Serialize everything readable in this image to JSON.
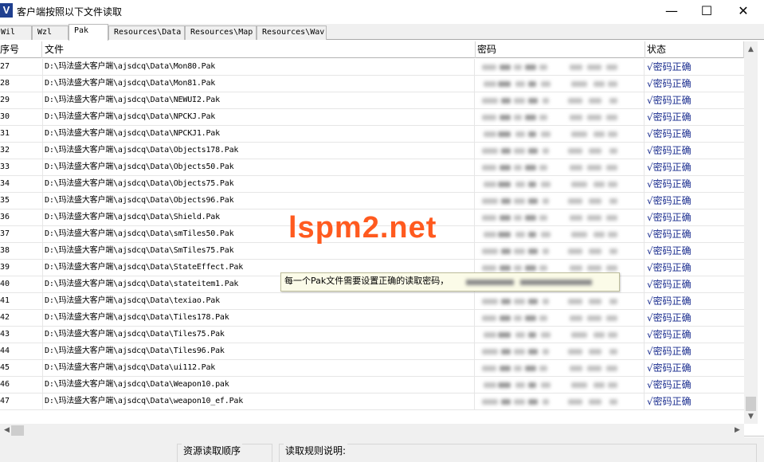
{
  "window": {
    "title": "客户端按照以下文件读取",
    "icon_letter": "V",
    "minimize": "—",
    "maximize": "☐",
    "close": "✕"
  },
  "tabs": [
    "Wil",
    "Wzl",
    "Pak",
    "Resources\\Data",
    "Resources\\Map",
    "Resources\\Wav"
  ],
  "active_tab": "Pak",
  "columns": {
    "id": "序号",
    "file": "文件",
    "password": "密码",
    "status": "状态"
  },
  "rows": [
    {
      "id": "27",
      "file": "D:\\玛法盛大客户端\\ajsdcq\\Data\\Mon80.Pak",
      "status": "√密码正确"
    },
    {
      "id": "28",
      "file": "D:\\玛法盛大客户端\\ajsdcq\\Data\\Mon81.Pak",
      "status": "√密码正确"
    },
    {
      "id": "29",
      "file": "D:\\玛法盛大客户端\\ajsdcq\\Data\\NEWUI2.Pak",
      "status": "√密码正确"
    },
    {
      "id": "30",
      "file": "D:\\玛法盛大客户端\\ajsdcq\\Data\\NPCKJ.Pak",
      "status": "√密码正确"
    },
    {
      "id": "31",
      "file": "D:\\玛法盛大客户端\\ajsdcq\\Data\\NPCKJ1.Pak",
      "status": "√密码正确"
    },
    {
      "id": "32",
      "file": "D:\\玛法盛大客户端\\ajsdcq\\Data\\Objects178.Pak",
      "status": "√密码正确"
    },
    {
      "id": "33",
      "file": "D:\\玛法盛大客户端\\ajsdcq\\Data\\Objects50.Pak",
      "status": "√密码正确"
    },
    {
      "id": "34",
      "file": "D:\\玛法盛大客户端\\ajsdcq\\Data\\Objects75.Pak",
      "status": "√密码正确"
    },
    {
      "id": "35",
      "file": "D:\\玛法盛大客户端\\ajsdcq\\Data\\Objects96.Pak",
      "status": "√密码正确"
    },
    {
      "id": "36",
      "file": "D:\\玛法盛大客户端\\ajsdcq\\Data\\Shield.Pak",
      "status": "√密码正确"
    },
    {
      "id": "37",
      "file": "D:\\玛法盛大客户端\\ajsdcq\\Data\\smTiles50.Pak",
      "status": "√密码正确"
    },
    {
      "id": "38",
      "file": "D:\\玛法盛大客户端\\ajsdcq\\Data\\SmTiles75.Pak",
      "status": "√密码正确"
    },
    {
      "id": "39",
      "file": "D:\\玛法盛大客户端\\ajsdcq\\Data\\StateEffect.Pak",
      "status": "√密码正确"
    },
    {
      "id": "40",
      "file": "D:\\玛法盛大客户端\\ajsdcq\\Data\\stateitem1.Pak",
      "status": "√密码正确"
    },
    {
      "id": "41",
      "file": "D:\\玛法盛大客户端\\ajsdcq\\Data\\texiao.Pak",
      "status": "√密码正确"
    },
    {
      "id": "42",
      "file": "D:\\玛法盛大客户端\\ajsdcq\\Data\\Tiles178.Pak",
      "status": "√密码正确"
    },
    {
      "id": "43",
      "file": "D:\\玛法盛大客户端\\ajsdcq\\Data\\Tiles75.Pak",
      "status": "√密码正确"
    },
    {
      "id": "44",
      "file": "D:\\玛法盛大客户端\\ajsdcq\\Data\\Tiles96.Pak",
      "status": "√密码正确"
    },
    {
      "id": "45",
      "file": "D:\\玛法盛大客户端\\ajsdcq\\Data\\ui112.Pak",
      "status": "√密码正确"
    },
    {
      "id": "46",
      "file": "D:\\玛法盛大客户端\\ajsdcq\\Data\\Weapon10.pak",
      "status": "√密码正确"
    },
    {
      "id": "47",
      "file": "D:\\玛法盛大客户端\\ajsdcq\\Data\\weapon10_ef.Pak",
      "status": "√密码正确"
    }
  ],
  "watermark": "lspm2.net",
  "tooltip": "每一个Pak文件需要设置正确的读取密码，",
  "scrollbar_icons": {
    "up": "▲",
    "down": "▼",
    "left": "◀",
    "right": "▶"
  },
  "bottom": {
    "resource_order_label": "资源读取顺序",
    "rules_label": "读取规则说明:"
  }
}
